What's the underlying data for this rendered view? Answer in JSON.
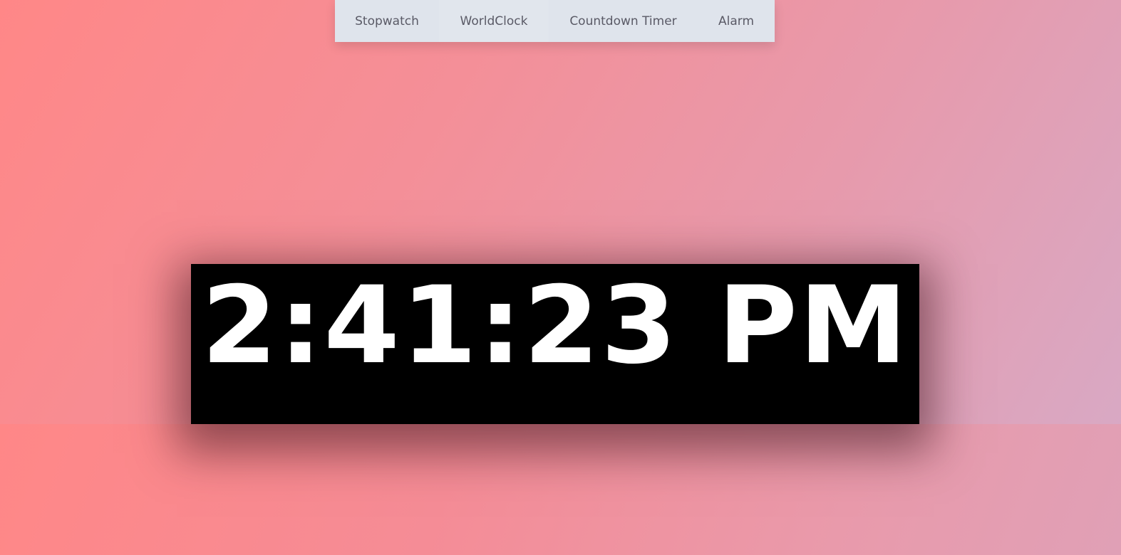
{
  "nav": {
    "items": [
      {
        "label": "Stopwatch"
      },
      {
        "label": "WorldClock"
      },
      {
        "label": "Countdown Timer"
      },
      {
        "label": "Alarm"
      }
    ]
  },
  "clock": {
    "time": "2:41:23 PM"
  }
}
